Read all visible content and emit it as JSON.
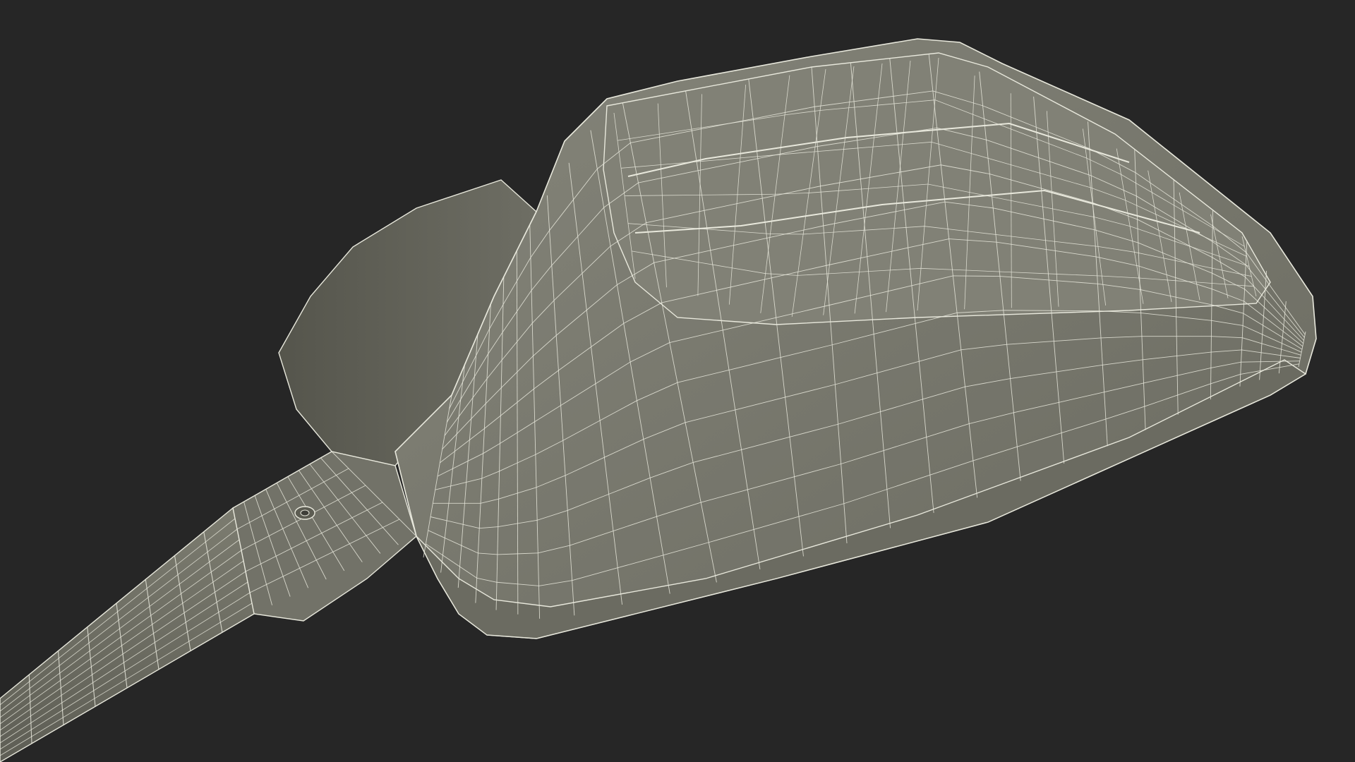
{
  "scene": {
    "background_color": "#262626",
    "model_fill_color": "#7a7a6e",
    "model_shadow_color": "#5c5c52",
    "model_highlight_color": "#8a8a7e",
    "wire_color": "#e8e8dc",
    "subject": "scoop-wireframe-model"
  }
}
